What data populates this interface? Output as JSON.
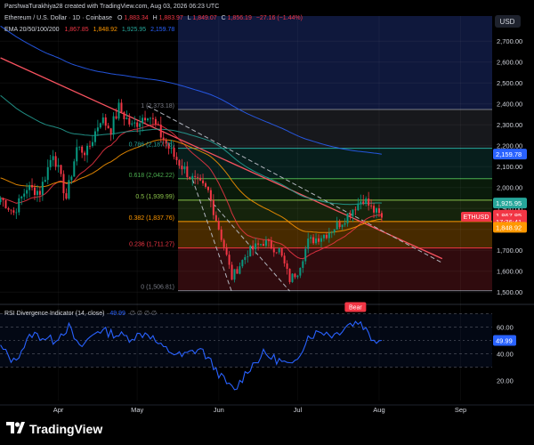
{
  "header": {
    "author_line": "ParshwaTurakhiya28 created with TradingView.com, Aug 03, 2026 06:23 UTC",
    "symbol_title": "Ethereum / U.S. Dollar · 1D · Coinbase",
    "o_label": "O",
    "o_value": "1,883.34",
    "h_label": "H",
    "h_value": "1,883.97",
    "l_label": "L",
    "l_value": "1,849.07",
    "c_label": "C",
    "c_value": "1,856.19",
    "change": "−27.16 (−1.44%)",
    "ema_label": "EMA 20/50/100/200",
    "ema20": "1,867.85",
    "ema50": "1,848.92",
    "ema100": "1,925.95",
    "ema200": "2,159.78"
  },
  "currency": "USD",
  "rsi": {
    "label": "RSI Divergence Indicator (14, close)",
    "value": "49.99",
    "bear_label": "Bear",
    "ticks": [
      "60.00",
      "40.00",
      "20.00"
    ]
  },
  "brand": {
    "name": "TradingView"
  },
  "colors": {
    "ema20": "#f23645",
    "ema50": "#ff9800",
    "ema100": "#26a69a",
    "ema200": "#2962ff",
    "up": "#089981",
    "down": "#f23645",
    "rsi_line": "#2962ff",
    "trendline": "#f7525f"
  },
  "chart_data": {
    "type": "candlestick",
    "title": "Ethereum / U.S. Dollar · 1D · Coinbase",
    "ylabel": "USD",
    "ylim": [
      1450,
      2820
    ],
    "yticks": [
      1500,
      1600,
      1700,
      1800,
      1900,
      2000,
      2100,
      2200,
      2300,
      2400,
      2500,
      2600,
      2700
    ],
    "y_tick_labels": [
      "1,500.00",
      "1,600.00",
      "1,700.00",
      "1,800.00",
      "1,900.00",
      "2,000.00",
      "2,100.00",
      "2,200.00",
      "2,300.00",
      "2,400.00",
      "2,500.00",
      "2,600.00",
      "2,700.00"
    ],
    "x_labels": [
      {
        "label": "Apr",
        "date": "2026-04-01"
      },
      {
        "label": "May",
        "date": "2026-05-01"
      },
      {
        "label": "Jun",
        "date": "2026-06-01"
      },
      {
        "label": "Jul",
        "date": "2026-07-01"
      },
      {
        "label": "Aug",
        "date": "2026-08-01"
      },
      {
        "label": "Sep",
        "date": "2026-09-01"
      }
    ],
    "price_anchors": [
      [
        "2026-03-10",
        1950
      ],
      [
        "2026-03-15",
        1880
      ],
      [
        "2026-03-20",
        2000
      ],
      [
        "2026-03-25",
        1980
      ],
      [
        "2026-03-30",
        2170
      ],
      [
        "2026-04-04",
        1950
      ],
      [
        "2026-04-08",
        2190
      ],
      [
        "2026-04-12",
        2170
      ],
      [
        "2026-04-17",
        2330
      ],
      [
        "2026-04-21",
        2280
      ],
      [
        "2026-04-24",
        2380
      ],
      [
        "2026-04-29",
        2290
      ],
      [
        "2026-05-05",
        2360
      ],
      [
        "2026-05-10",
        2250
      ],
      [
        "2026-05-15",
        2150
      ],
      [
        "2026-05-22",
        2040
      ],
      [
        "2026-05-28",
        1980
      ],
      [
        "2026-06-03",
        1720
      ],
      [
        "2026-06-06",
        1570
      ],
      [
        "2026-06-12",
        1690
      ],
      [
        "2026-06-18",
        1740
      ],
      [
        "2026-06-24",
        1700
      ],
      [
        "2026-06-28",
        1560
      ],
      [
        "2026-07-01",
        1600
      ],
      [
        "2026-07-05",
        1740
      ],
      [
        "2026-07-12",
        1780
      ],
      [
        "2026-07-18",
        1840
      ],
      [
        "2026-07-22",
        1900
      ],
      [
        "2026-07-26",
        1950
      ],
      [
        "2026-07-29",
        1900
      ],
      [
        "2026-08-02",
        1856
      ]
    ],
    "last_close": 1856.19,
    "emas": [
      {
        "name": "EMA 20",
        "last": 1867.85
      },
      {
        "name": "EMA 50",
        "last": 1848.92
      },
      {
        "name": "EMA 100",
        "last": 1925.95
      },
      {
        "name": "EMA 200",
        "last": 2159.78
      }
    ],
    "fib_levels": [
      {
        "ratio": "0.786",
        "price": 2187.76,
        "label": "0.786 (2,187.76)",
        "color": "#26a69a"
      },
      {
        "ratio": "0.618",
        "price": 2042.22,
        "label": "0.618 (2,042.22)",
        "color": "#4caf50"
      },
      {
        "ratio": "0.5",
        "price": 1939.99,
        "label": "0.5 (1,939.99)",
        "color": "#8bc34a"
      },
      {
        "ratio": "0.382",
        "price": 1837.76,
        "label": "0.382 (1,837.76)",
        "color": "#ff9800"
      },
      {
        "ratio": "0.236",
        "price": 1711.27,
        "label": "0.236 (1,711.27)",
        "color": "#f23645"
      },
      {
        "ratio": "0",
        "price": 1506.81,
        "label": "0 (1,506.81)",
        "color": "#787b86"
      },
      {
        "ratio": "1",
        "price": 2373.18,
        "label": "1 (2,373.18)",
        "color": "#787b86"
      }
    ],
    "price_badges": [
      {
        "text": "2,159.78",
        "price": 2159.78,
        "color": "#2962ff"
      },
      {
        "text": "1,925.95",
        "price": 1925.95,
        "color": "#26a69a"
      },
      {
        "text": "1,867.85",
        "price": 1867.85,
        "color": "#f23645"
      },
      {
        "text": "17:36:41",
        "price": 1837,
        "color": "#f23645"
      },
      {
        "text": "1,848.92",
        "price": 1810,
        "color": "#ff9800"
      }
    ],
    "symbol_badge": "ETHUSD",
    "rsi": {
      "ylim": [
        5,
        75
      ],
      "value": 49.99,
      "anchors": [
        [
          "2026-03-10",
          45
        ],
        [
          "2026-03-15",
          34
        ],
        [
          "2026-03-22",
          55
        ],
        [
          "2026-03-30",
          50
        ],
        [
          "2026-04-05",
          60
        ],
        [
          "2026-04-09",
          44
        ],
        [
          "2026-04-16",
          58
        ],
        [
          "2026-04-22",
          55
        ],
        [
          "2026-04-28",
          52
        ],
        [
          "2026-05-05",
          56
        ],
        [
          "2026-05-10",
          45
        ],
        [
          "2026-05-18",
          38
        ],
        [
          "2026-05-25",
          44
        ],
        [
          "2026-06-03",
          20
        ],
        [
          "2026-06-07",
          12
        ],
        [
          "2026-06-12",
          28
        ],
        [
          "2026-06-18",
          40
        ],
        [
          "2026-06-25",
          34
        ],
        [
          "2026-06-29",
          30
        ],
        [
          "2026-07-05",
          53
        ],
        [
          "2026-07-10",
          57
        ],
        [
          "2026-07-15",
          54
        ],
        [
          "2026-07-20",
          62
        ],
        [
          "2026-07-25",
          64
        ],
        [
          "2026-07-29",
          52
        ],
        [
          "2026-08-02",
          49.99
        ]
      ]
    }
  }
}
